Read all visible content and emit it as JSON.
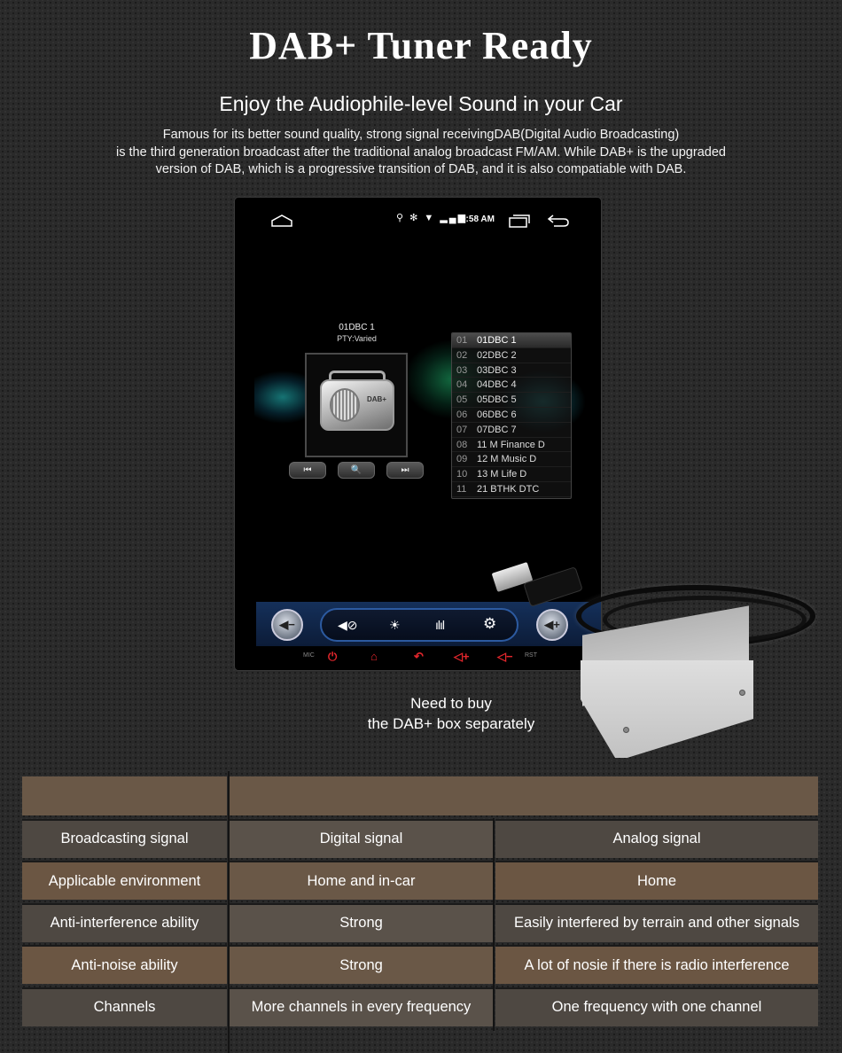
{
  "header": {
    "title": "DAB+ Tuner Ready",
    "subtitle": "Enjoy the Audiophile-level Sound in your Car",
    "description_lines": [
      "Famous for its better sound quality, strong signal receivingDAB(Digital Audio Broadcasting)",
      "is the third generation broadcast after the traditional analog broadcast FM/AM. While DAB+ is the upgraded",
      "version of DAB, which is a progressive transition of DAB, and it is also compatiable with DAB."
    ]
  },
  "screen": {
    "statusbar": {
      "icons": [
        "home-icon",
        "location-icon",
        "bluetooth-icon",
        "wifi-icon",
        "4g-signal-icon",
        "recent-apps-icon",
        "back-icon"
      ],
      "status_glyphs": "⚲ ✻ ▼ ▂▄▆",
      "time": "9:58 AM"
    },
    "now_playing": {
      "station": "01DBC 1",
      "pty": "PTY:Varied",
      "album_label": "DAB+"
    },
    "controls": {
      "prev": "⏮",
      "search": "🔍",
      "next": "⏭"
    },
    "station_list": [
      {
        "num": "01",
        "name": "01DBC 1",
        "active": true
      },
      {
        "num": "02",
        "name": "02DBC 2"
      },
      {
        "num": "03",
        "name": "03DBC 3"
      },
      {
        "num": "04",
        "name": "04DBC 4"
      },
      {
        "num": "05",
        "name": "05DBC 5"
      },
      {
        "num": "06",
        "name": "06DBC 6"
      },
      {
        "num": "07",
        "name": "07DBC 7"
      },
      {
        "num": "08",
        "name": "11 M Finance D"
      },
      {
        "num": "09",
        "name": "12 M Music D"
      },
      {
        "num": "10",
        "name": "13 M Life D"
      },
      {
        "num": "11",
        "name": "21 BTHK DTC"
      }
    ],
    "bottom_bar": {
      "vol_down": "◀−",
      "vol_up": "◀+",
      "mute": "◀⊘",
      "brightness": "☀",
      "eq": "ılıl",
      "settings": "⚙"
    },
    "hardware_keys": {
      "mic_label": "MIC",
      "power": "⏻",
      "home": "⌂",
      "back": "↶",
      "vol_up": "◁+",
      "vol_down": "◁−",
      "rst_label": "RST",
      "color": "#e3262c"
    }
  },
  "note": {
    "line1": "Need to buy",
    "line2": "the DAB+ box separately"
  },
  "table": {
    "header": [
      "",
      ""
    ],
    "rows": [
      [
        "Broadcasting signal",
        "Digital signal",
        "Analog signal"
      ],
      [
        "Applicable environment",
        "Home and in-car",
        "Home"
      ],
      [
        "Anti-interference ability",
        "Strong",
        "Easily interfered by terrain and other signals"
      ],
      [
        "Anti-noise ability",
        "Strong",
        "A lot of nosie if there is radio interference"
      ],
      [
        "Channels",
        "More channels in every frequency",
        "One frequency with one channel"
      ]
    ]
  },
  "colors": {
    "background": "#2a2a2a",
    "table_brown": "#6a5847",
    "table_gray": "#4e4842",
    "bar_blue": "#15305a",
    "accent_red": "#e3262c"
  }
}
